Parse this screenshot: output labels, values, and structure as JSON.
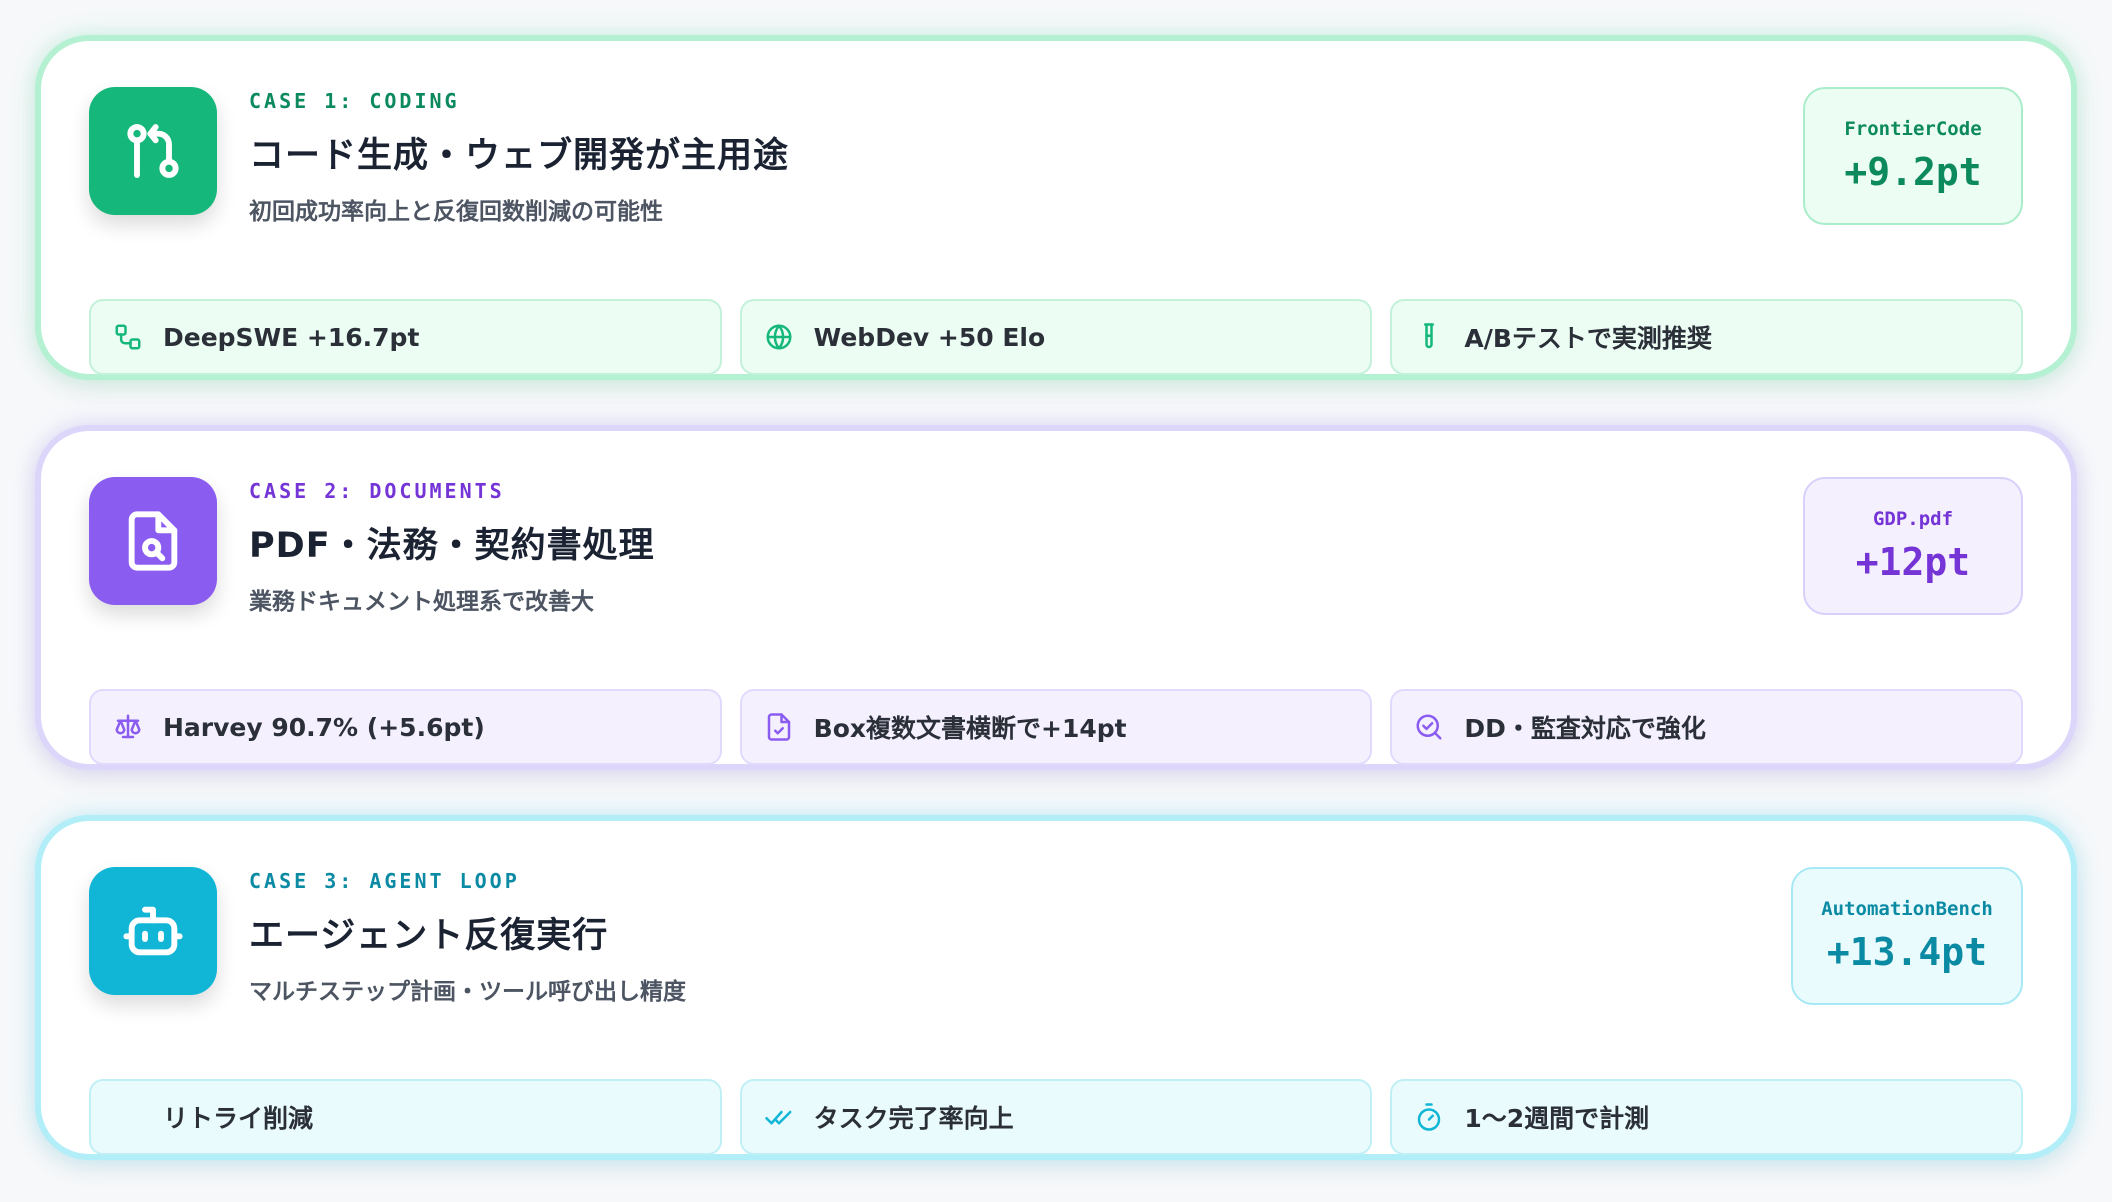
{
  "colors": {
    "green": "#15b87a",
    "purple": "#8b5cf0",
    "cyan": "#11b6d6"
  },
  "cases": [
    {
      "label": "CASE 1: CODING",
      "icon": "git-pull-request-icon",
      "title": "コード生成・ウェブ開発が主用途",
      "subtitle": "初回成功率向上と反復回数削減の可能性",
      "badge": {
        "label": "FrontierCode",
        "value": "+9.2pt"
      },
      "chips": [
        {
          "icon": "workflow-icon",
          "text": "DeepSWE +16.7pt"
        },
        {
          "icon": "globe-icon",
          "text": "WebDev +50 Elo"
        },
        {
          "icon": "test-tube-icon",
          "text": "A/Bテストで実測推奨"
        }
      ]
    },
    {
      "label": "CASE 2: DOCUMENTS",
      "icon": "file-search-icon",
      "title": "PDF・法務・契約書処理",
      "subtitle": "業務ドキュメント処理系で改善大",
      "badge": {
        "label": "GDP.pdf",
        "value": "+12pt"
      },
      "chips": [
        {
          "icon": "scale-icon",
          "text": "Harvey 90.7% (+5.6pt)"
        },
        {
          "icon": "file-check-icon",
          "text": "Box複数文書横断で+14pt"
        },
        {
          "icon": "circle-check-icon",
          "text": "DD・監査対応で強化"
        }
      ]
    },
    {
      "label": "CASE 3: AGENT LOOP",
      "icon": "robot-icon",
      "title": "エージェント反復実行",
      "subtitle": "マルチステップ計画・ツール呼び出し精度",
      "badge": {
        "label": "AutomationBench",
        "value": "+13.4pt"
      },
      "chips": [
        {
          "icon": "retry-icon",
          "text": "リトライ削減"
        },
        {
          "icon": "double-check-icon",
          "text": "タスク完了率向上"
        },
        {
          "icon": "timer-icon",
          "text": "1〜2週間で計測"
        }
      ]
    }
  ]
}
